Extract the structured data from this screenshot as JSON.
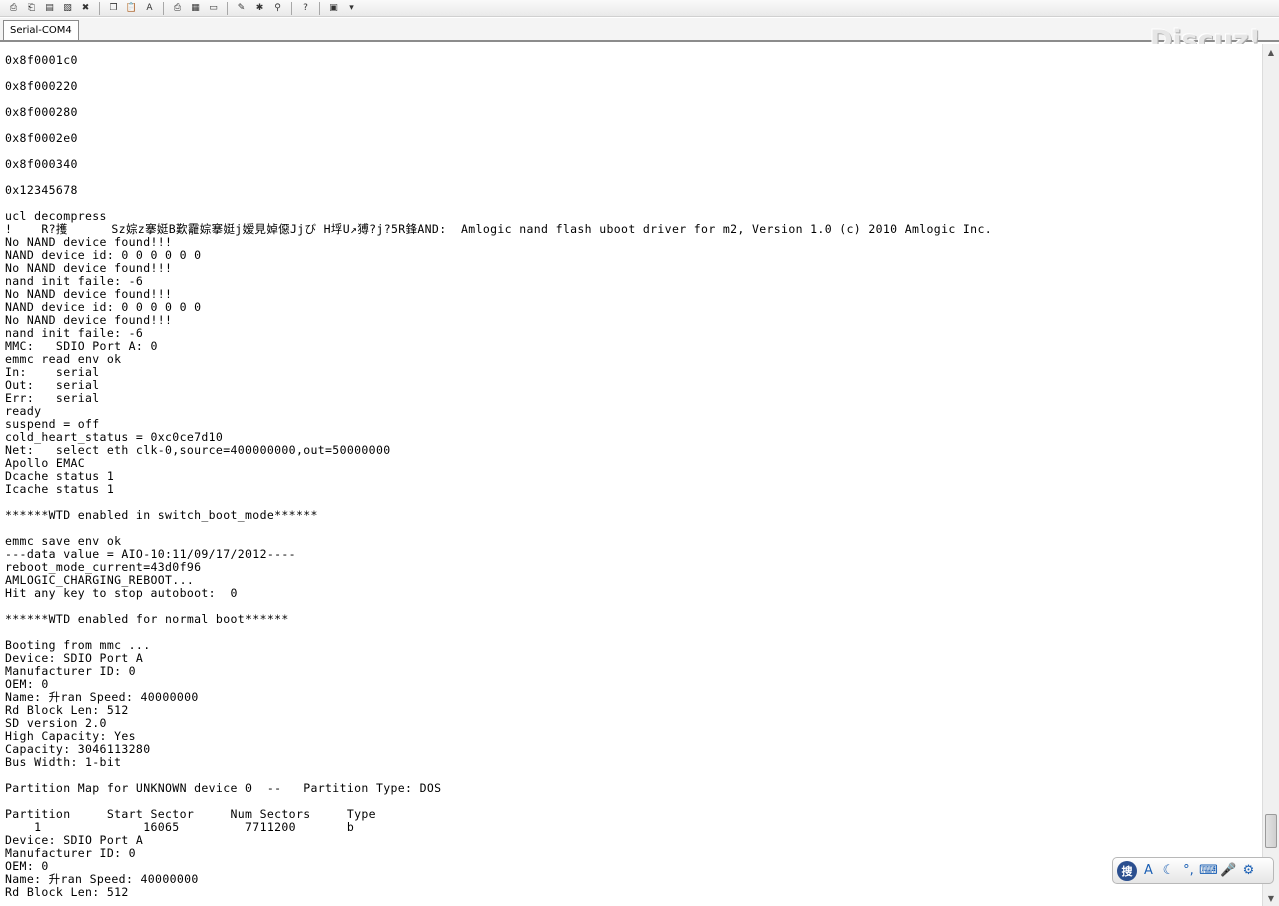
{
  "toolbar": {
    "buttons": [
      {
        "name": "connect-icon",
        "glyph": "⎙"
      },
      {
        "name": "disconnect-icon",
        "glyph": "⎗"
      },
      {
        "name": "save-icon",
        "glyph": "▤"
      },
      {
        "name": "clear-icon",
        "glyph": "▧"
      },
      {
        "name": "close-icon",
        "glyph": "✖"
      },
      {
        "name": "copy-icon",
        "glyph": "❐"
      },
      {
        "name": "paste-icon",
        "glyph": "📋"
      },
      {
        "name": "find-icon",
        "glyph": "A"
      },
      {
        "name": "print-icon",
        "glyph": "⎙"
      },
      {
        "name": "print-preview-icon",
        "glyph": "▦"
      },
      {
        "name": "printer-icon",
        "glyph": "▭"
      },
      {
        "name": "settings-icon",
        "glyph": "✎"
      },
      {
        "name": "tools-icon",
        "glyph": "✱"
      },
      {
        "name": "pin-icon",
        "glyph": "⚲"
      },
      {
        "name": "help-icon",
        "glyph": "?"
      },
      {
        "name": "options-icon",
        "glyph": "▣"
      },
      {
        "name": "dropdown-arrow-icon",
        "glyph": "▾"
      }
    ]
  },
  "tab": {
    "label": "Serial-COM4"
  },
  "watermark": "Discuz!",
  "terminal": {
    "lines": [
      "0x8f0001c0",
      "",
      "0x8f000220",
      "",
      "0x8f000280",
      "",
      "0x8f0002e0",
      "",
      "0x8f000340",
      "",
      "0x12345678",
      "",
      "ucl decompress",
      "!    R?擭      Sz婃z搴娗B歎龗婃搴娗j嫒見婥僫Jjび H垺U↗猼?j?5R鋒AND:  Amlogic nand flash uboot driver for m2, Version 1.0 (c) 2010 Amlogic Inc.",
      "No NAND device found!!!",
      "NAND device id: 0 0 0 0 0 0",
      "No NAND device found!!!",
      "nand init faile: -6",
      "No NAND device found!!!",
      "NAND device id: 0 0 0 0 0 0",
      "No NAND device found!!!",
      "nand init faile: -6",
      "MMC:   SDIO Port A: 0",
      "emmc read env ok",
      "In:    serial",
      "Out:   serial",
      "Err:   serial",
      "ready",
      "suspend = off",
      "cold_heart_status = 0xc0ce7d10",
      "Net:   select eth clk-0,source=400000000,out=50000000",
      "Apollo EMAC",
      "Dcache status 1",
      "Icache status 1",
      "",
      "******WTD enabled in switch_boot_mode******",
      "",
      "emmc save env ok",
      "---data value = AIO-10:11/09/17/2012----",
      "reboot_mode_current=43d0f96",
      "AMLOGIC_CHARGING_REBOOT...",
      "Hit any key to stop autoboot:  0",
      "",
      "******WTD enabled for normal boot******",
      "",
      "Booting from mmc ...",
      "Device: SDIO Port A",
      "Manufacturer ID: 0",
      "OEM: 0",
      "Name: 升ran Speed: 40000000",
      "Rd Block Len: 512",
      "SD version 2.0",
      "High Capacity: Yes",
      "Capacity: 3046113280",
      "Bus Width: 1-bit",
      "",
      "Partition Map for UNKNOWN device 0  --   Partition Type: DOS",
      "",
      "Partition     Start Sector     Num Sectors     Type",
      "    1              16065         7711200       b",
      "Device: SDIO Port A",
      "Manufacturer ID: 0",
      "OEM: 0",
      "Name: 升ran Speed: 40000000",
      "Rd Block Len: 512"
    ]
  },
  "scrollbar": {
    "up": "▲",
    "down": "▼"
  },
  "ime": {
    "logo": "搜",
    "buttons": [
      {
        "name": "ime-mode-icon",
        "glyph": "A"
      },
      {
        "name": "ime-moon-icon",
        "glyph": "☾"
      },
      {
        "name": "ime-punctuation-icon",
        "glyph": "°,"
      },
      {
        "name": "ime-keyboard-icon",
        "glyph": "⌨"
      },
      {
        "name": "ime-microphone-icon",
        "glyph": "🎤"
      },
      {
        "name": "ime-settings-icon",
        "glyph": "⚙"
      }
    ]
  }
}
